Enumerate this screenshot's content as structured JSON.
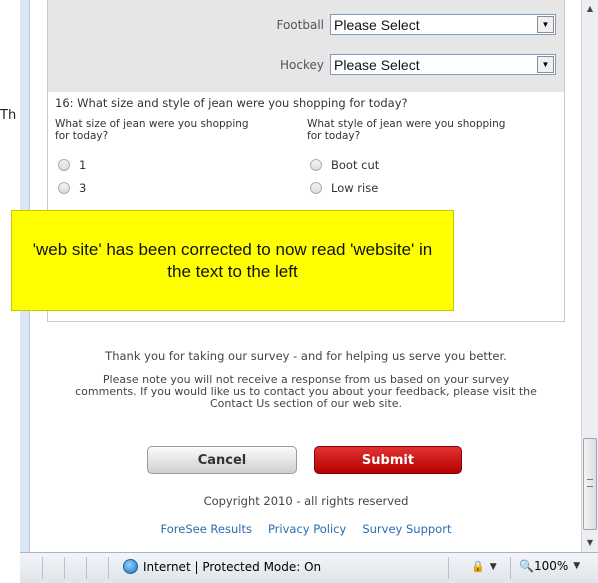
{
  "partial_left_text": "Th",
  "selects": [
    {
      "label": "Football",
      "value": "Please Select"
    },
    {
      "label": "Hockey",
      "value": "Please Select"
    }
  ],
  "question16": {
    "title": "16: What size and style of jean were you shopping for today?",
    "size_header": "What size of jean were you shopping for today?",
    "style_header": "What style of jean were you shopping for today?",
    "size_options": [
      "1",
      "3"
    ],
    "style_options": [
      "Boot cut",
      "Low rise"
    ]
  },
  "note": {
    "text": "'web site' has been corrected to now read 'website' in the text to the left",
    "color": "#ffff00"
  },
  "footer": {
    "thanks": "Thank you for taking our survey - and for helping us serve you better.",
    "notice": "Please note you will not receive a response from us based on your survey comments. If you would like us to contact you about your feedback, please visit the Contact Us section of our web site.",
    "cancel_label": "Cancel",
    "submit_label": "Submit",
    "copyright": "Copyright 2010 - all rights reserved",
    "links": [
      "ForeSee Results",
      "Privacy Policy",
      "Survey Support"
    ],
    "submit_color": "#c80000",
    "link_color": "#2b6cb0"
  },
  "statusbar": {
    "zone": "Internet | Protected Mode: On",
    "zoom": "100%"
  }
}
